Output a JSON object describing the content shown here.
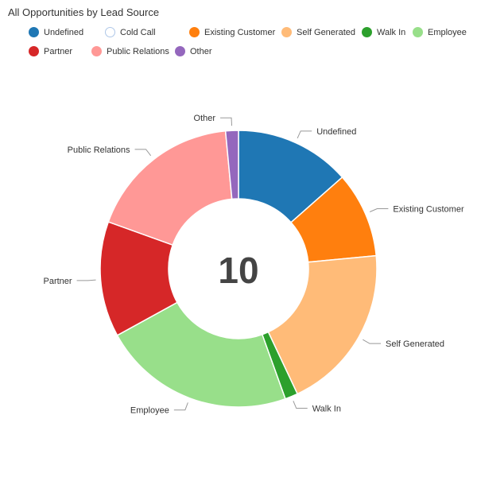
{
  "title": "All Opportunities by Lead Source",
  "center_value": "10",
  "chart_data": {
    "type": "pie",
    "style": "donut",
    "title": "All Opportunities by Lead Source",
    "total": 10,
    "categories": [
      "Undefined",
      "Cold Call",
      "Existing Customer",
      "Self Generated",
      "Walk In",
      "Employee",
      "Partner",
      "Public Relations",
      "Other"
    ],
    "values": [
      1.35,
      0,
      1.0,
      1.95,
      0.15,
      2.25,
      1.35,
      1.8,
      0.15
    ],
    "colors": [
      "#1f77b4",
      "#aec7e8",
      "#ff7f0e",
      "#ffbb78",
      "#2ca02c",
      "#98df8a",
      "#d62728",
      "#ff9896",
      "#9467bd"
    ],
    "legend_position": "top-left"
  },
  "legend": {
    "row1": [
      {
        "label": "Undefined",
        "color": "#1f77b4",
        "hollow": false
      },
      {
        "label": "Cold Call",
        "color": "#aec7e8",
        "hollow": true
      },
      {
        "label": "Existing Customer",
        "color": "#ff7f0e",
        "hollow": false
      },
      {
        "label": "Self Generated",
        "color": "#ffbb78",
        "hollow": false
      },
      {
        "label": "Walk In",
        "color": "#2ca02c",
        "hollow": false
      },
      {
        "label": "Employee",
        "color": "#98df8a",
        "hollow": false
      }
    ],
    "row2": [
      {
        "label": "Partner",
        "color": "#d62728",
        "hollow": false
      },
      {
        "label": "Public Relations",
        "color": "#ff9896",
        "hollow": false
      },
      {
        "label": "Other",
        "color": "#9467bd",
        "hollow": false
      }
    ]
  }
}
